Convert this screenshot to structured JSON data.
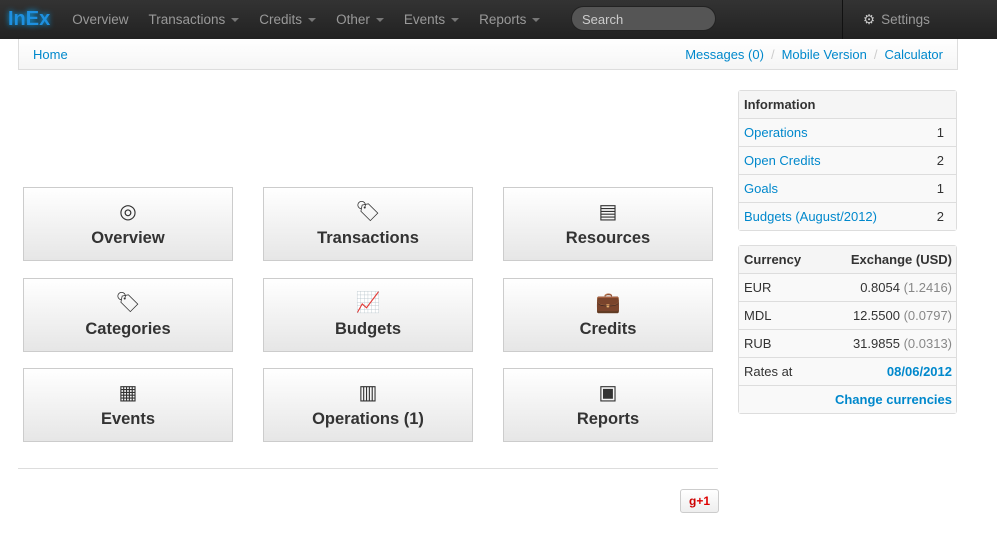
{
  "nav": {
    "brand": "InEx",
    "items": [
      {
        "label": "Overview"
      },
      {
        "label": "Transactions",
        "dropdown": true
      },
      {
        "label": "Credits",
        "dropdown": true
      },
      {
        "label": "Other",
        "dropdown": true
      },
      {
        "label": "Events",
        "dropdown": true
      },
      {
        "label": "Reports",
        "dropdown": true
      }
    ],
    "search_placeholder": "Search",
    "settings": "Settings"
  },
  "breadcrumb": {
    "home": "Home",
    "links": [
      "Messages (0)",
      "Mobile Version",
      "Calculator"
    ]
  },
  "tiles": [
    {
      "label": "Overview",
      "icon": "radar-icon"
    },
    {
      "label": "Transactions",
      "icon": "tag-icon"
    },
    {
      "label": "Resources",
      "icon": "wallet-icon"
    },
    {
      "label": "Categories",
      "icon": "tags-icon"
    },
    {
      "label": "Budgets",
      "icon": "chart-icon"
    },
    {
      "label": "Credits",
      "icon": "briefcase-icon"
    },
    {
      "label": "Events",
      "icon": "calendar-icon"
    },
    {
      "label": "Operations (1)",
      "icon": "receipt-icon"
    },
    {
      "label": "Reports",
      "icon": "presentation-icon"
    }
  ],
  "gplus": "+1",
  "information": {
    "title": "Information",
    "rows": [
      {
        "label": "Operations",
        "value": "1"
      },
      {
        "label": "Open Credits",
        "value": "2"
      },
      {
        "label": "Goals",
        "value": "1"
      },
      {
        "label": "Budgets (August/2012)",
        "value": "2"
      }
    ]
  },
  "currency": {
    "col1": "Currency",
    "col2": "Exchange (USD)",
    "rows": [
      {
        "code": "EUR",
        "rate": "0.8054",
        "inverse": "(1.2416)"
      },
      {
        "code": "MDL",
        "rate": "12.5500",
        "inverse": "(0.0797)"
      },
      {
        "code": "RUB",
        "rate": "31.9855",
        "inverse": "(0.0313)"
      }
    ],
    "rates_at_label": "Rates at",
    "rates_date": "08/06/2012",
    "change": "Change currencies"
  }
}
